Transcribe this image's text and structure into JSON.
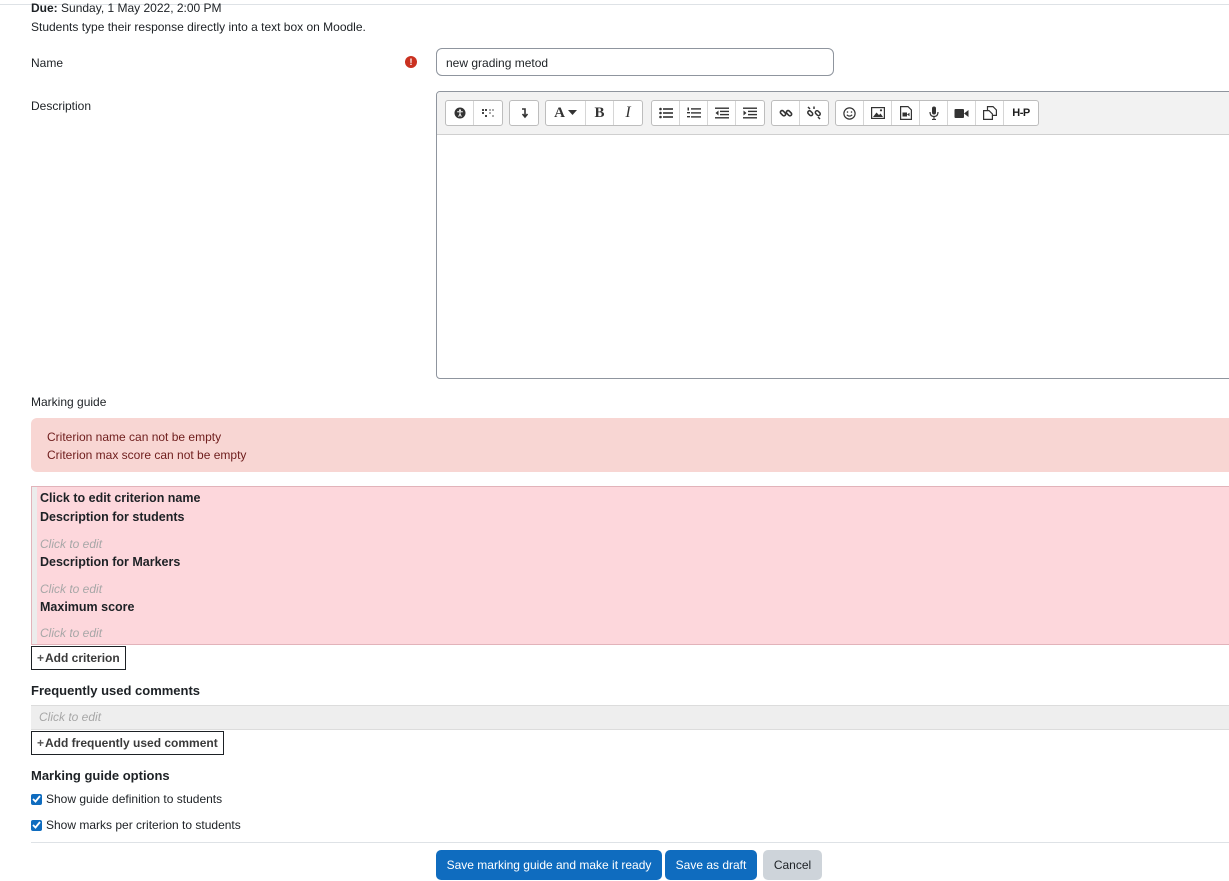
{
  "header": {
    "due_label": "Due:",
    "due_value": "Sunday, 1 May 2022, 2:00 PM",
    "subtitle": "Students type their response directly into a text box on Moodle."
  },
  "form": {
    "name_label": "Name",
    "name_value": "new grading metod",
    "description_label": "Description",
    "marking_guide_label": "Marking guide"
  },
  "toolbar": {
    "groups": [
      [
        "accessibility-checker-icon",
        "screenreader-helper-icon"
      ],
      [
        "paragraph-break-icon"
      ],
      [
        "font-style-dropdown-icon",
        "bold-icon",
        "italic-icon"
      ],
      [
        "unordered-list-icon",
        "ordered-list-icon",
        "outdent-icon",
        "indent-icon"
      ],
      [
        "link-icon",
        "unlink-icon"
      ],
      [
        "emoji-icon",
        "image-icon",
        "media-icon",
        "record-audio-icon",
        "record-video-icon",
        "manage-files-icon",
        "h5p-icon"
      ]
    ],
    "font_letter": "A",
    "bold_letter": "B",
    "italic_letter": "I",
    "h5p_text": "H-P"
  },
  "errors": [
    "Criterion name can not be empty",
    "Criterion max score can not be empty"
  ],
  "criterion": {
    "name": "Click to edit criterion name",
    "desc_students_label": "Description for students",
    "desc_students_hint": "Click to edit",
    "desc_markers_label": "Description for Markers",
    "desc_markers_hint": "Click to edit",
    "max_score_label": "Maximum score",
    "max_score_hint": "Click to edit"
  },
  "add_criterion_label": "Add criterion",
  "comments": {
    "heading": "Frequently used comments",
    "hint": "Click to edit",
    "add_label": "Add frequently used comment"
  },
  "options": {
    "heading": "Marking guide options",
    "show_definition": "Show guide definition to students",
    "show_marks": "Show marks per criterion to students"
  },
  "actions": {
    "save_ready": "Save marking guide and make it ready",
    "save_draft": "Save as draft",
    "cancel": "Cancel"
  },
  "colors": {
    "primary": "#0f6cbf",
    "error_bg": "#f8d6d3",
    "criterion_bg": "#fdd7dc",
    "required": "#ca3120"
  }
}
